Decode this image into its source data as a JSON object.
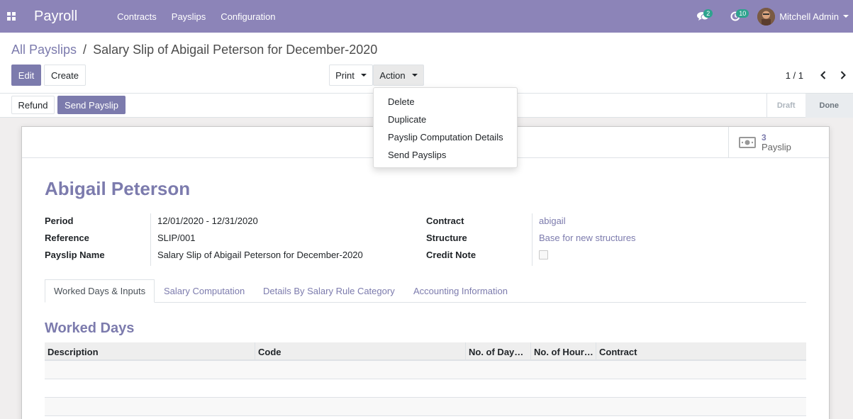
{
  "navbar": {
    "app_name": "Payroll",
    "menu": [
      "Contracts",
      "Payslips",
      "Configuration"
    ],
    "messages_badge": "2",
    "activities_badge": "10",
    "user_name": "Mitchell Admin"
  },
  "breadcrumb": {
    "parent": "All Payslips",
    "separator": "/",
    "current": "Salary Slip of Abigail Peterson for December-2020"
  },
  "toolbar": {
    "edit_label": "Edit",
    "create_label": "Create",
    "print_label": "Print",
    "action_label": "Action",
    "pager_value": "1 / 1"
  },
  "action_menu": {
    "items": [
      "Delete",
      "Duplicate",
      "Payslip Computation Details",
      "Send Payslips"
    ]
  },
  "statusbar": {
    "refund_label": "Refund",
    "send_label": "Send Payslip",
    "steps": [
      "Draft",
      "Done"
    ],
    "current_step": "Done"
  },
  "smart_button": {
    "value": "3",
    "label": "Payslip"
  },
  "form": {
    "employee": "Abigail Peterson",
    "left": {
      "period_label": "Period",
      "period_value": "12/01/2020 - 12/31/2020",
      "reference_label": "Reference",
      "reference_value": "SLIP/001",
      "name_label": "Payslip Name",
      "name_value": "Salary Slip of Abigail Peterson for December-2020"
    },
    "right": {
      "contract_label": "Contract",
      "contract_value": "abigail",
      "structure_label": "Structure",
      "structure_value": "Base for new structures",
      "credit_note_label": "Credit Note",
      "credit_note_checked": false
    }
  },
  "tabs": [
    "Worked Days & Inputs",
    "Salary Computation",
    "Details By Salary Rule Category",
    "Accounting Information"
  ],
  "worked_days": {
    "title": "Worked Days",
    "columns": [
      "Description",
      "Code",
      "No. of Day…",
      "No. of Hour…",
      "Contract"
    ]
  },
  "colors": {
    "navbar": "#8c84b8",
    "primary": "#7c7bad"
  }
}
